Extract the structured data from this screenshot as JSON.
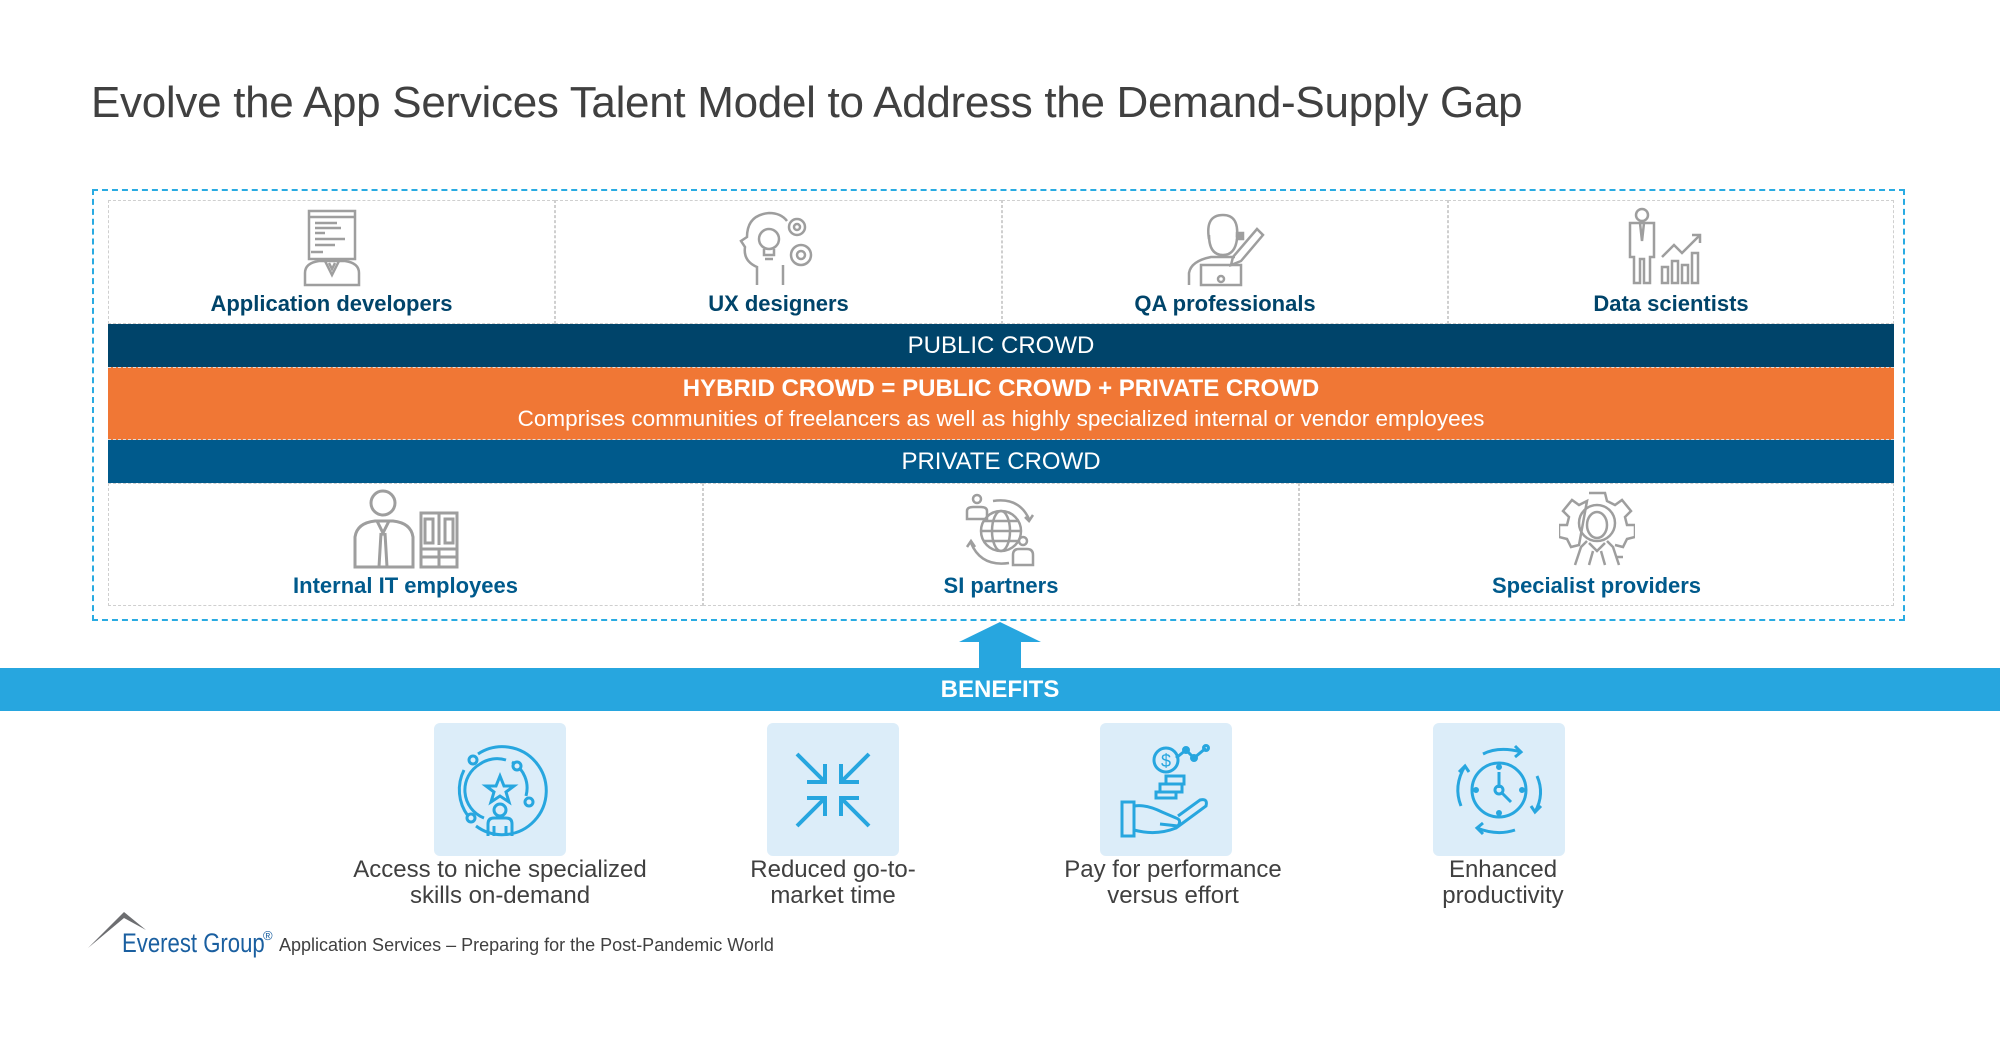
{
  "title": "Evolve the App Services Talent Model to Address the Demand-Supply Gap",
  "public_roles": [
    {
      "label": "Application developers",
      "icon": "developer-icon"
    },
    {
      "label": "UX designers",
      "icon": "ux-designer-icon"
    },
    {
      "label": "QA professionals",
      "icon": "qa-professional-icon"
    },
    {
      "label": "Data scientists",
      "icon": "data-scientist-icon"
    }
  ],
  "bands": {
    "public": "PUBLIC CROWD",
    "hybrid_title": "HYBRID CROWD = PUBLIC CROWD + PRIVATE CROWD",
    "hybrid_desc": "Comprises communities of freelancers as well as highly specialized internal or vendor employees",
    "private": "PRIVATE CROWD"
  },
  "private_roles": [
    {
      "label": "Internal IT employees",
      "icon": "it-employee-icon"
    },
    {
      "label": "SI partners",
      "icon": "global-partners-icon"
    },
    {
      "label": "Specialist providers",
      "icon": "specialist-gear-icon"
    }
  ],
  "benefits": {
    "header": "BENEFITS",
    "items": [
      {
        "line1": "Access to niche specialized",
        "line2": "skills on-demand",
        "icon": "talent-star-icon"
      },
      {
        "line1": "Reduced go-to-",
        "line2": "market time",
        "icon": "compress-arrows-icon"
      },
      {
        "line1": "Pay for performance",
        "line2": "versus effort",
        "icon": "payment-hand-icon"
      },
      {
        "line1": "Enhanced",
        "line2": "productivity",
        "icon": "clock-cycle-icon"
      }
    ]
  },
  "footer": {
    "brand": "Everest Group",
    "registered": "®",
    "subtitle": "Application Services – Preparing for the Post-Pandemic World"
  },
  "colors": {
    "public_band": "#00446a",
    "hybrid_band": "#f07735",
    "private_band": "#005a8c",
    "benefits_bar": "#27a6df",
    "tile_bg": "#dcedf9",
    "icon_gray": "#9e9e9e",
    "icon_blue": "#27a6df"
  }
}
